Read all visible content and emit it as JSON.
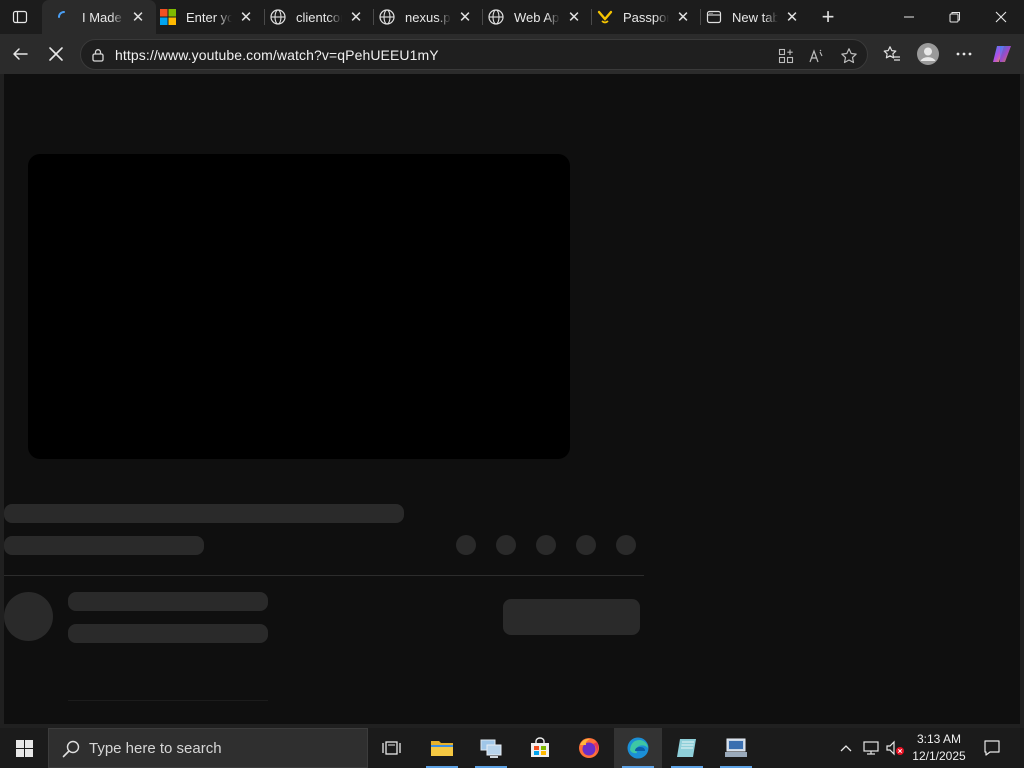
{
  "browser": {
    "tabs": [
      {
        "title": "I Made M",
        "icon": "loading-spinner-icon",
        "active": true
      },
      {
        "title": "Enter you",
        "icon": "microsoft-logo-icon",
        "active": false
      },
      {
        "title": "clientcon",
        "icon": "globe-icon",
        "active": false
      },
      {
        "title": "nexus.pa",
        "icon": "globe-icon",
        "active": false
      },
      {
        "title": "Web App",
        "icon": "globe-icon",
        "active": false
      },
      {
        "title": "Passport",
        "icon": "passport-favicon-icon",
        "active": false
      },
      {
        "title": "New tab",
        "icon": "newtab-page-icon",
        "active": false
      }
    ],
    "url": "https://www.youtube.com/watch?v=qPehUEEU1mY",
    "colors": {
      "tabstrip": "#1c1c1c",
      "toolbar": "#2b2b2b",
      "page": "#0f0f0f",
      "skeleton": "#2a2a2a"
    }
  },
  "taskbar": {
    "search_placeholder": "Type here to search",
    "clock_time": "3:13 AM",
    "clock_date": "12/1/2025",
    "apps": [
      "task-view-icon",
      "file-explorer-icon",
      "network-app-icon",
      "microsoft-store-icon",
      "firefox-icon",
      "edge-icon",
      "notepad-app-icon",
      "remote-desktop-icon"
    ]
  }
}
